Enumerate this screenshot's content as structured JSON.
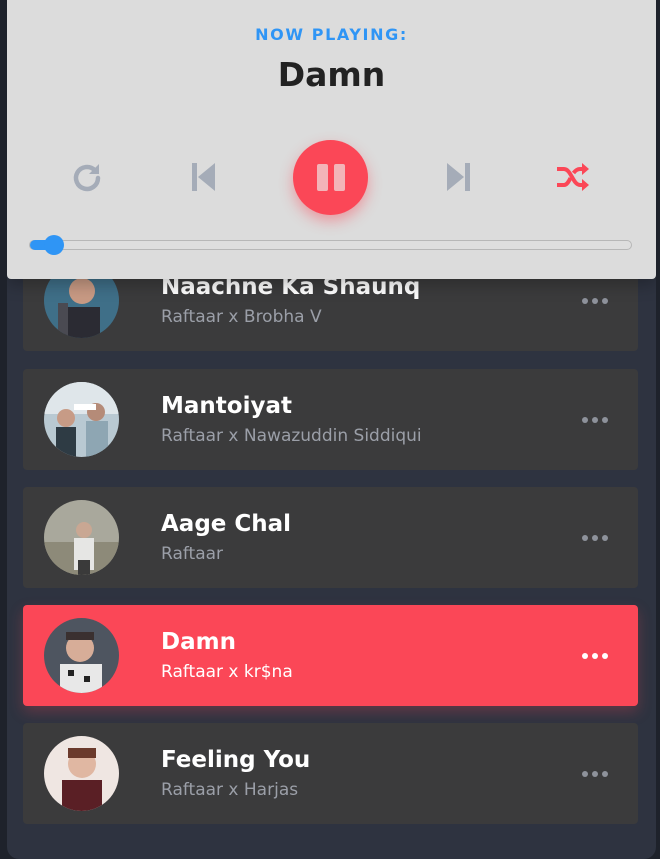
{
  "player": {
    "label": "NOW PLAYING:",
    "title": "Damn",
    "progress_fraction": 0.03,
    "colors": {
      "accent": "#2f95f5",
      "play": "#fb4757",
      "shuffle": "#fb4757",
      "icon": "#a5acb8"
    },
    "controls": [
      "repeat-icon",
      "previous-icon",
      "pause-icon",
      "next-icon",
      "shuffle-icon"
    ]
  },
  "songs": [
    {
      "title": "Naachne Ka Shaunq",
      "artist": "Raftaar x Brobha V",
      "active": false
    },
    {
      "title": "Mantoiyat",
      "artist": "Raftaar x Nawazuddin Siddiqui",
      "active": false
    },
    {
      "title": "Aage Chal",
      "artist": "Raftaar",
      "active": false
    },
    {
      "title": "Damn",
      "artist": "Raftaar x kr$na",
      "active": true
    },
    {
      "title": "Feeling You",
      "artist": "Raftaar x Harjas",
      "active": false
    }
  ]
}
